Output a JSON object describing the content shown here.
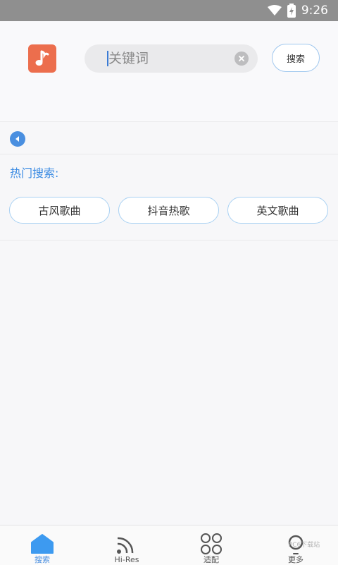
{
  "status_bar": {
    "time": "9:26",
    "icons": [
      "wifi-icon",
      "battery-icon"
    ]
  },
  "app": {
    "logo_icon": "music-note-icon",
    "accent_color": "#3b8be3",
    "logo_color": "#ec6e4d"
  },
  "search": {
    "placeholder": "关键词",
    "value": "",
    "clear_icon": "clear-icon",
    "button_label": "搜索"
  },
  "hot_search": {
    "title": "热门搜索:",
    "tags": [
      "古风歌曲",
      "抖音热歌",
      "英文歌曲"
    ]
  },
  "bottom_nav": {
    "items": [
      {
        "label": "搜索",
        "icon": "home-icon",
        "active": true
      },
      {
        "label": "Hi-Res",
        "icon": "rss-icon",
        "active": false
      },
      {
        "label": "适配",
        "icon": "grid-circles-icon",
        "active": false
      },
      {
        "label": "更多",
        "icon": "more-icon",
        "active": false
      }
    ]
  },
  "watermark": "PC6下载站"
}
